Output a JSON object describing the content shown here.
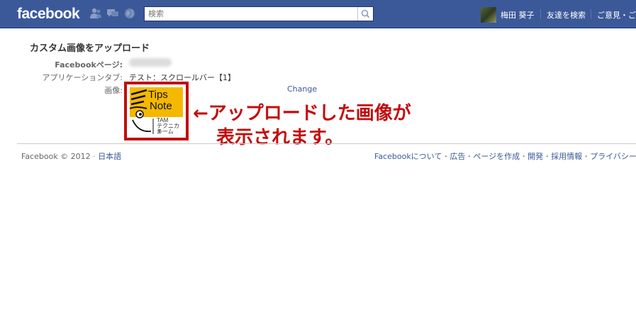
{
  "header": {
    "logo": "facebook",
    "search_placeholder": "検索",
    "user_name": "梅田 葵子",
    "find_friends": "友達を検索",
    "feedback": "ご意見・ご"
  },
  "upload": {
    "title": "カスタム画像をアップロード",
    "facebook_page_label": "Facebookページ:",
    "app_tab_label": "アプリケーションタブ:",
    "app_tab_value": "テスト：スクロールバー【1】",
    "image_label": "画像:",
    "change_link": "Change"
  },
  "thumbnail": {
    "line1": "Tips",
    "line2": "Note",
    "line3": "TAM",
    "line4": "テクニカル",
    "line5": "チーム"
  },
  "annotation": {
    "line1": "←アップロードした画像が",
    "line2": "表示されます。"
  },
  "footer": {
    "copyright": "Facebook © 2012",
    "language": "日本語",
    "links": [
      "Facebookについて",
      "広告",
      "ページを作成",
      "開発",
      "採用情報",
      "プライバシー"
    ]
  },
  "colors": {
    "brand_blue": "#3b5998",
    "annotation_red": "#c30d0d",
    "thumb_yellow": "#f5b800"
  }
}
